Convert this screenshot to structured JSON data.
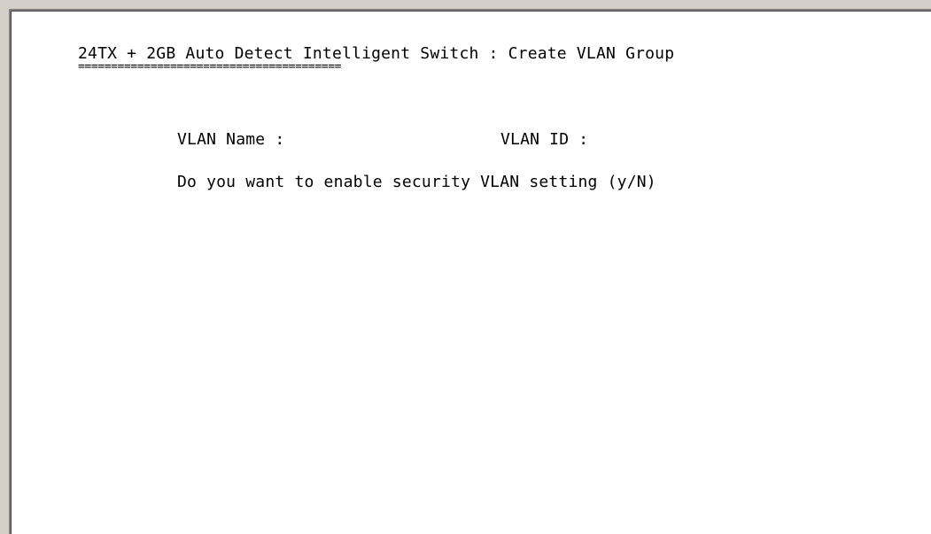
{
  "screen": {
    "title": "24TX + 2GB Auto Detect Intelligent Switch : Create VLAN Group",
    "title_underline": "========================================",
    "fields": {
      "vlan_name_label": "VLAN Name :",
      "vlan_id_label": "VLAN ID :"
    },
    "prompt": "Do you want to enable security VLAN setting (y/N)"
  },
  "colors": {
    "terminal_background": "#ffffff",
    "text": "#000000",
    "window_background": "#d4d0c8"
  }
}
